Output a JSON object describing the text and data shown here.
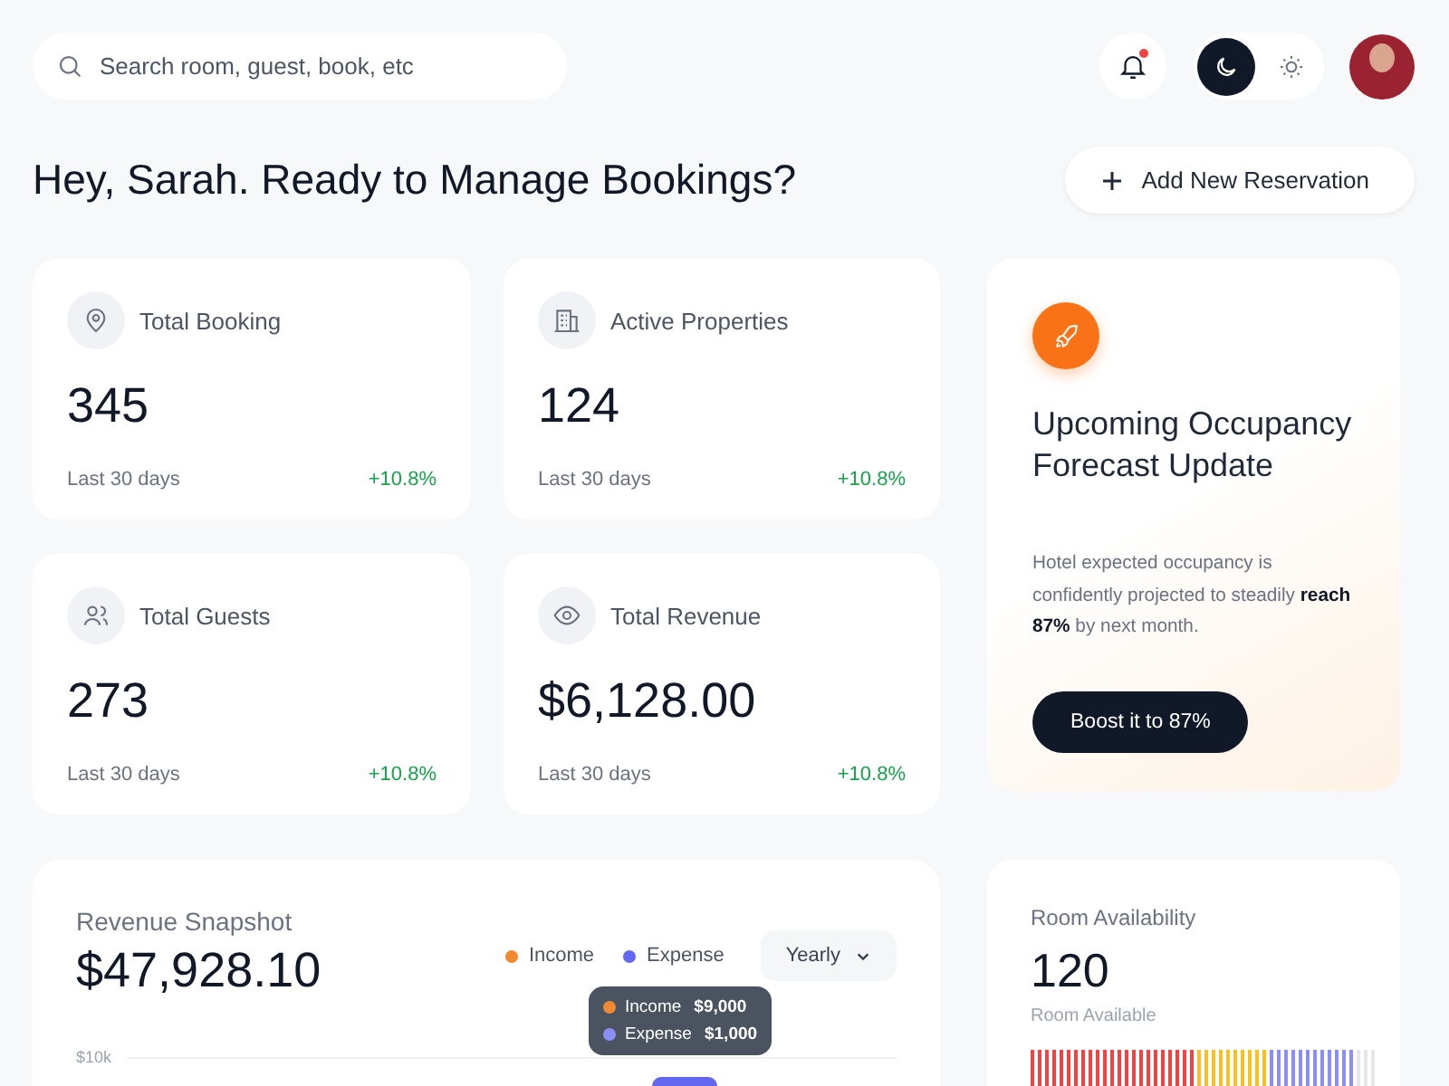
{
  "search": {
    "placeholder": "Search room, guest, book, etc"
  },
  "notifications": {
    "unread": true
  },
  "theme_modes": [
    {
      "kind": "dark",
      "selected": true
    },
    {
      "kind": "light",
      "selected": false
    }
  ],
  "greeting": "Hey, Sarah. Ready to Manage Bookings?",
  "add_button": "Add New Reservation",
  "stats": [
    {
      "kind": "pin",
      "label": "Total Booking",
      "value": "345",
      "period": "Last 30 days",
      "change": "+10.8%"
    },
    {
      "kind": "building",
      "label": "Active Properties",
      "value": "124",
      "period": "Last 30 days",
      "change": "+10.8%"
    },
    {
      "kind": "users",
      "label": "Total Guests",
      "value": "273",
      "period": "Last 30 days",
      "change": "+10.8%"
    },
    {
      "kind": "eye",
      "label": "Total Revenue",
      "value": "$6,128.00",
      "period": "Last 30 days",
      "change": "+10.8%"
    }
  ],
  "forecast": {
    "title": "Upcoming Occupancy Forecast Update",
    "text": "Hotel expected occupancy is confidently projected to steadily **reach 87%** by next month.",
    "button": "Boost it to 87%"
  },
  "revenue": {
    "title": "Revenue Snapshot",
    "total": "$47,928.10",
    "legend": [
      {
        "label": "Income",
        "color": "#f0892f"
      },
      {
        "label": "Expense",
        "color": "#6366f1"
      }
    ],
    "period": "Yearly",
    "tick_label": "$10k",
    "tooltip": [
      {
        "label": "Income",
        "value": "$9,000",
        "color": "#f0892f"
      },
      {
        "label": "Expense",
        "value": "$1,000",
        "color": "#8b8ff5"
      }
    ]
  },
  "availability": {
    "title": "Room Availability",
    "value": "120",
    "caption": "Room Available"
  }
}
